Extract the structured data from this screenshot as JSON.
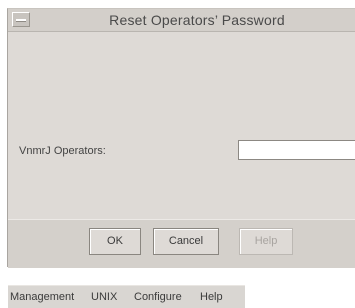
{
  "dialog": {
    "title": "Reset Operators’ Password",
    "operators_label": "VnmrJ Operators:",
    "operators_value": "",
    "buttons": {
      "ok": "OK",
      "cancel": "Cancel",
      "help": "Help"
    }
  },
  "menubar": {
    "items": [
      "Management",
      "UNIX",
      "Configure",
      "Help"
    ]
  },
  "icons": {
    "window_menu": "window-menu-icon"
  },
  "colors": {
    "dialog_bg": "#dedad6",
    "disabled_text": "#a8a4a0"
  }
}
